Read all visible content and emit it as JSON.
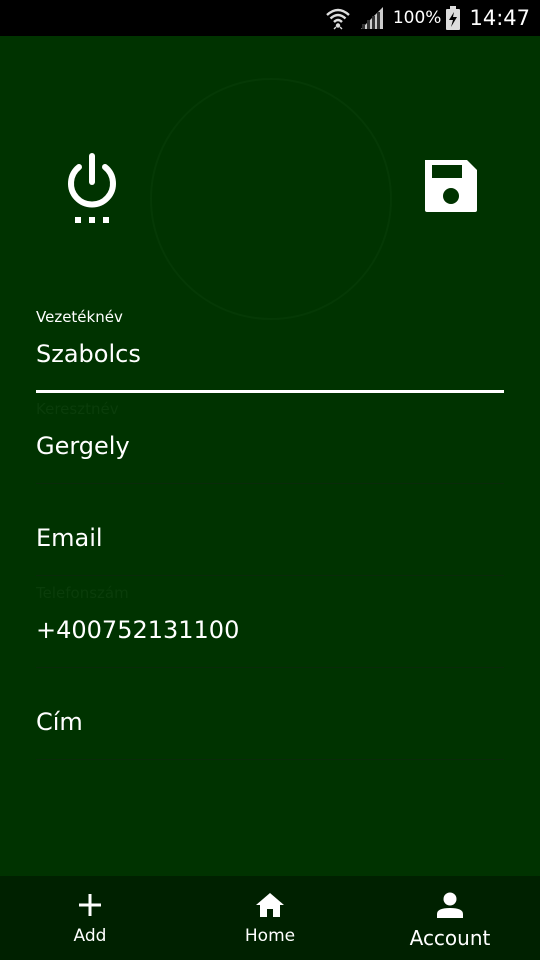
{
  "status_bar": {
    "battery_percent": "100%",
    "time": "14:47",
    "icons": [
      "wifi-icon",
      "signal-icon",
      "battery-charging-icon"
    ]
  },
  "actions": {
    "power_icon": "power-icon",
    "save_icon": "floppy-save-icon"
  },
  "form": {
    "last_name": {
      "label": "Vezetéknév",
      "value": "Szabolcs"
    },
    "first_name": {
      "label": "Keresztnév",
      "value": "Gergely"
    },
    "email": {
      "placeholder": "Email",
      "value": ""
    },
    "phone": {
      "label": "Telefonszám",
      "value": "+400752131100"
    },
    "address": {
      "placeholder": "Cím",
      "value": ""
    }
  },
  "bottom_nav": {
    "items": [
      {
        "label": "Add",
        "icon": "plus-icon"
      },
      {
        "label": "Home",
        "icon": "home-icon"
      },
      {
        "label": "Account",
        "icon": "person-icon",
        "selected": true
      }
    ]
  },
  "colors": {
    "background": "#003300",
    "nav_background": "#002100",
    "status_bar": "#000000",
    "accent": "#ffffff"
  }
}
